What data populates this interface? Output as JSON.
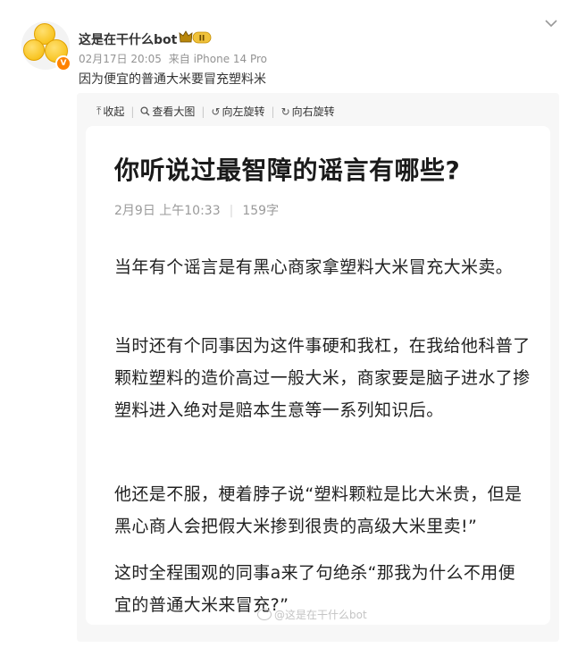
{
  "post": {
    "username": "这是在干什么bot",
    "badge_label": "II",
    "date": "02月17日 20:05",
    "source": "来自 iPhone 14 Pro",
    "text": "因为便宜的普通大米要冒充塑料米"
  },
  "toolbar": {
    "collapse": "收起",
    "view_large": "查看大图",
    "rotate_left": "向左旋转",
    "rotate_right": "向右旋转"
  },
  "article": {
    "title": "你听说过最智障的谣言有哪些?",
    "date": "2月9日 上午10:33",
    "word_count": "159字",
    "paragraphs": [
      "当年有个谣言是有黑心商家拿塑料大米冒充大米卖。",
      "当时还有个同事因为这件事硬和我杠，在我给他科普了颗粒塑料的造价高过一般大米，商家要是脑子进水了掺塑料进入绝对是赔本生意等一系列知识后。",
      "他还是不服，梗着脖子说“塑料颗粒是比大米贵，但是黑心商人会把假大米掺到很贵的高级大米里卖!”",
      "这时全程围观的同事a来了句绝杀“那我为什么不用便宜的普通大米来冒充?”"
    ]
  },
  "watermark": "@这是在干什么bot",
  "colors": {
    "accent": "#ff8200",
    "panel_bg": "#f7f7f7",
    "meta_text": "#939393"
  },
  "icons": {
    "verified": "verified-v-icon",
    "more": "chevron-down-icon",
    "collapse": "arrow-up-icon",
    "view_large": "magnifier-icon",
    "rotate_left": "rotate-left-icon",
    "rotate_right": "rotate-right-icon"
  }
}
